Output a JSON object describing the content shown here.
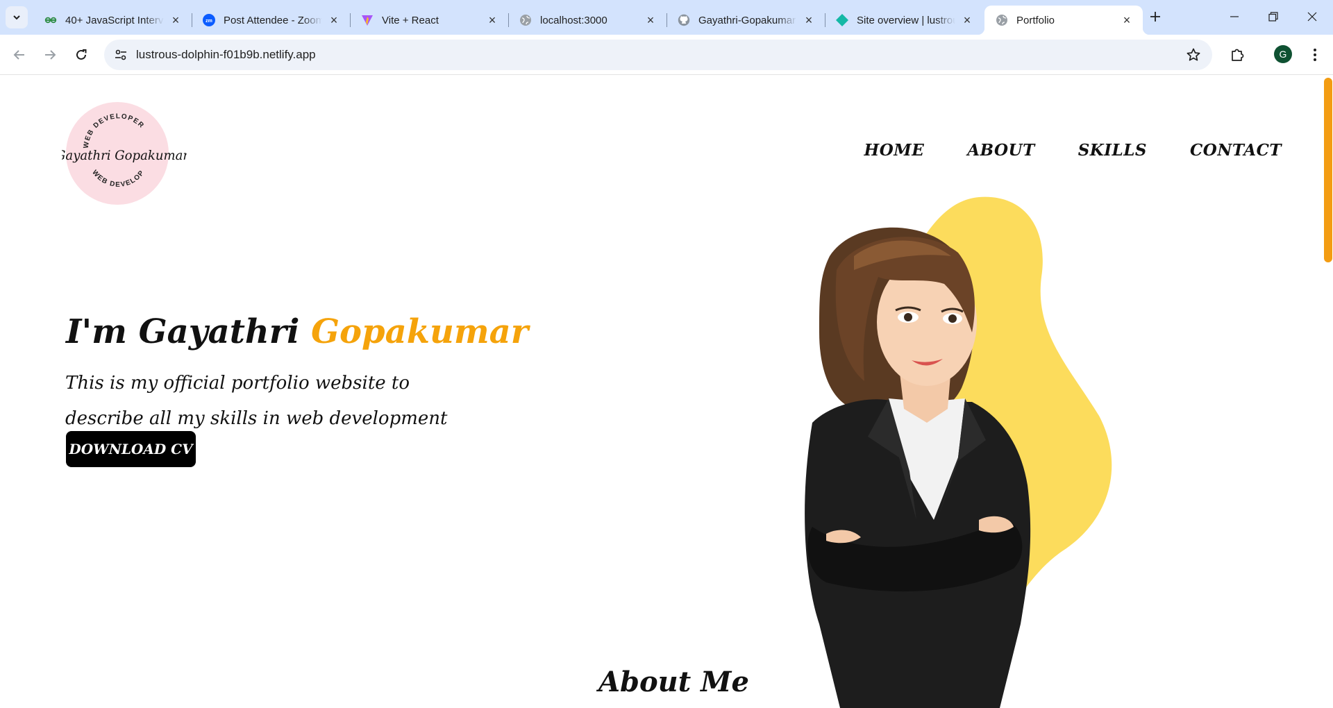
{
  "browser": {
    "tabs": [
      {
        "title": "40+ JavaScript Interv",
        "icon": "geeksforgeeks-icon",
        "active": false
      },
      {
        "title": "Post Attendee - Zoom",
        "icon": "zoom-icon",
        "active": false
      },
      {
        "title": "Vite + React",
        "icon": "vite-icon",
        "active": false
      },
      {
        "title": "localhost:3000",
        "icon": "globe-icon",
        "active": false
      },
      {
        "title": "Gayathri-Gopakumar",
        "icon": "github-icon",
        "active": false
      },
      {
        "title": "Site overview | lustrous",
        "icon": "netlify-icon",
        "active": false
      },
      {
        "title": "Portfolio",
        "icon": "globe-icon",
        "active": true
      }
    ],
    "url": "lustrous-dolphin-f01b9b.netlify.app",
    "profile_initial": "G"
  },
  "site": {
    "logo": {
      "name": "Gayathri Gopakumar",
      "arc_top": "WEB DEVELOPER",
      "arc_bottom": "WEB DEVELOPER"
    },
    "nav": [
      "HOME",
      "ABOUT",
      "SKILLS",
      "CONTACT"
    ],
    "hero": {
      "greeting": "I'm Gayathri",
      "highlight": "Gopakumar",
      "description": "This is my official portfolio website to describe all my skills in web development",
      "cta": "DOWNLOAD CV"
    },
    "about_heading": "About Me"
  },
  "colors": {
    "accent": "#f5a30b",
    "blob": "#fcdc5c",
    "logo_circle": "#fbdde3",
    "tabstrip": "#d3e3fd"
  }
}
